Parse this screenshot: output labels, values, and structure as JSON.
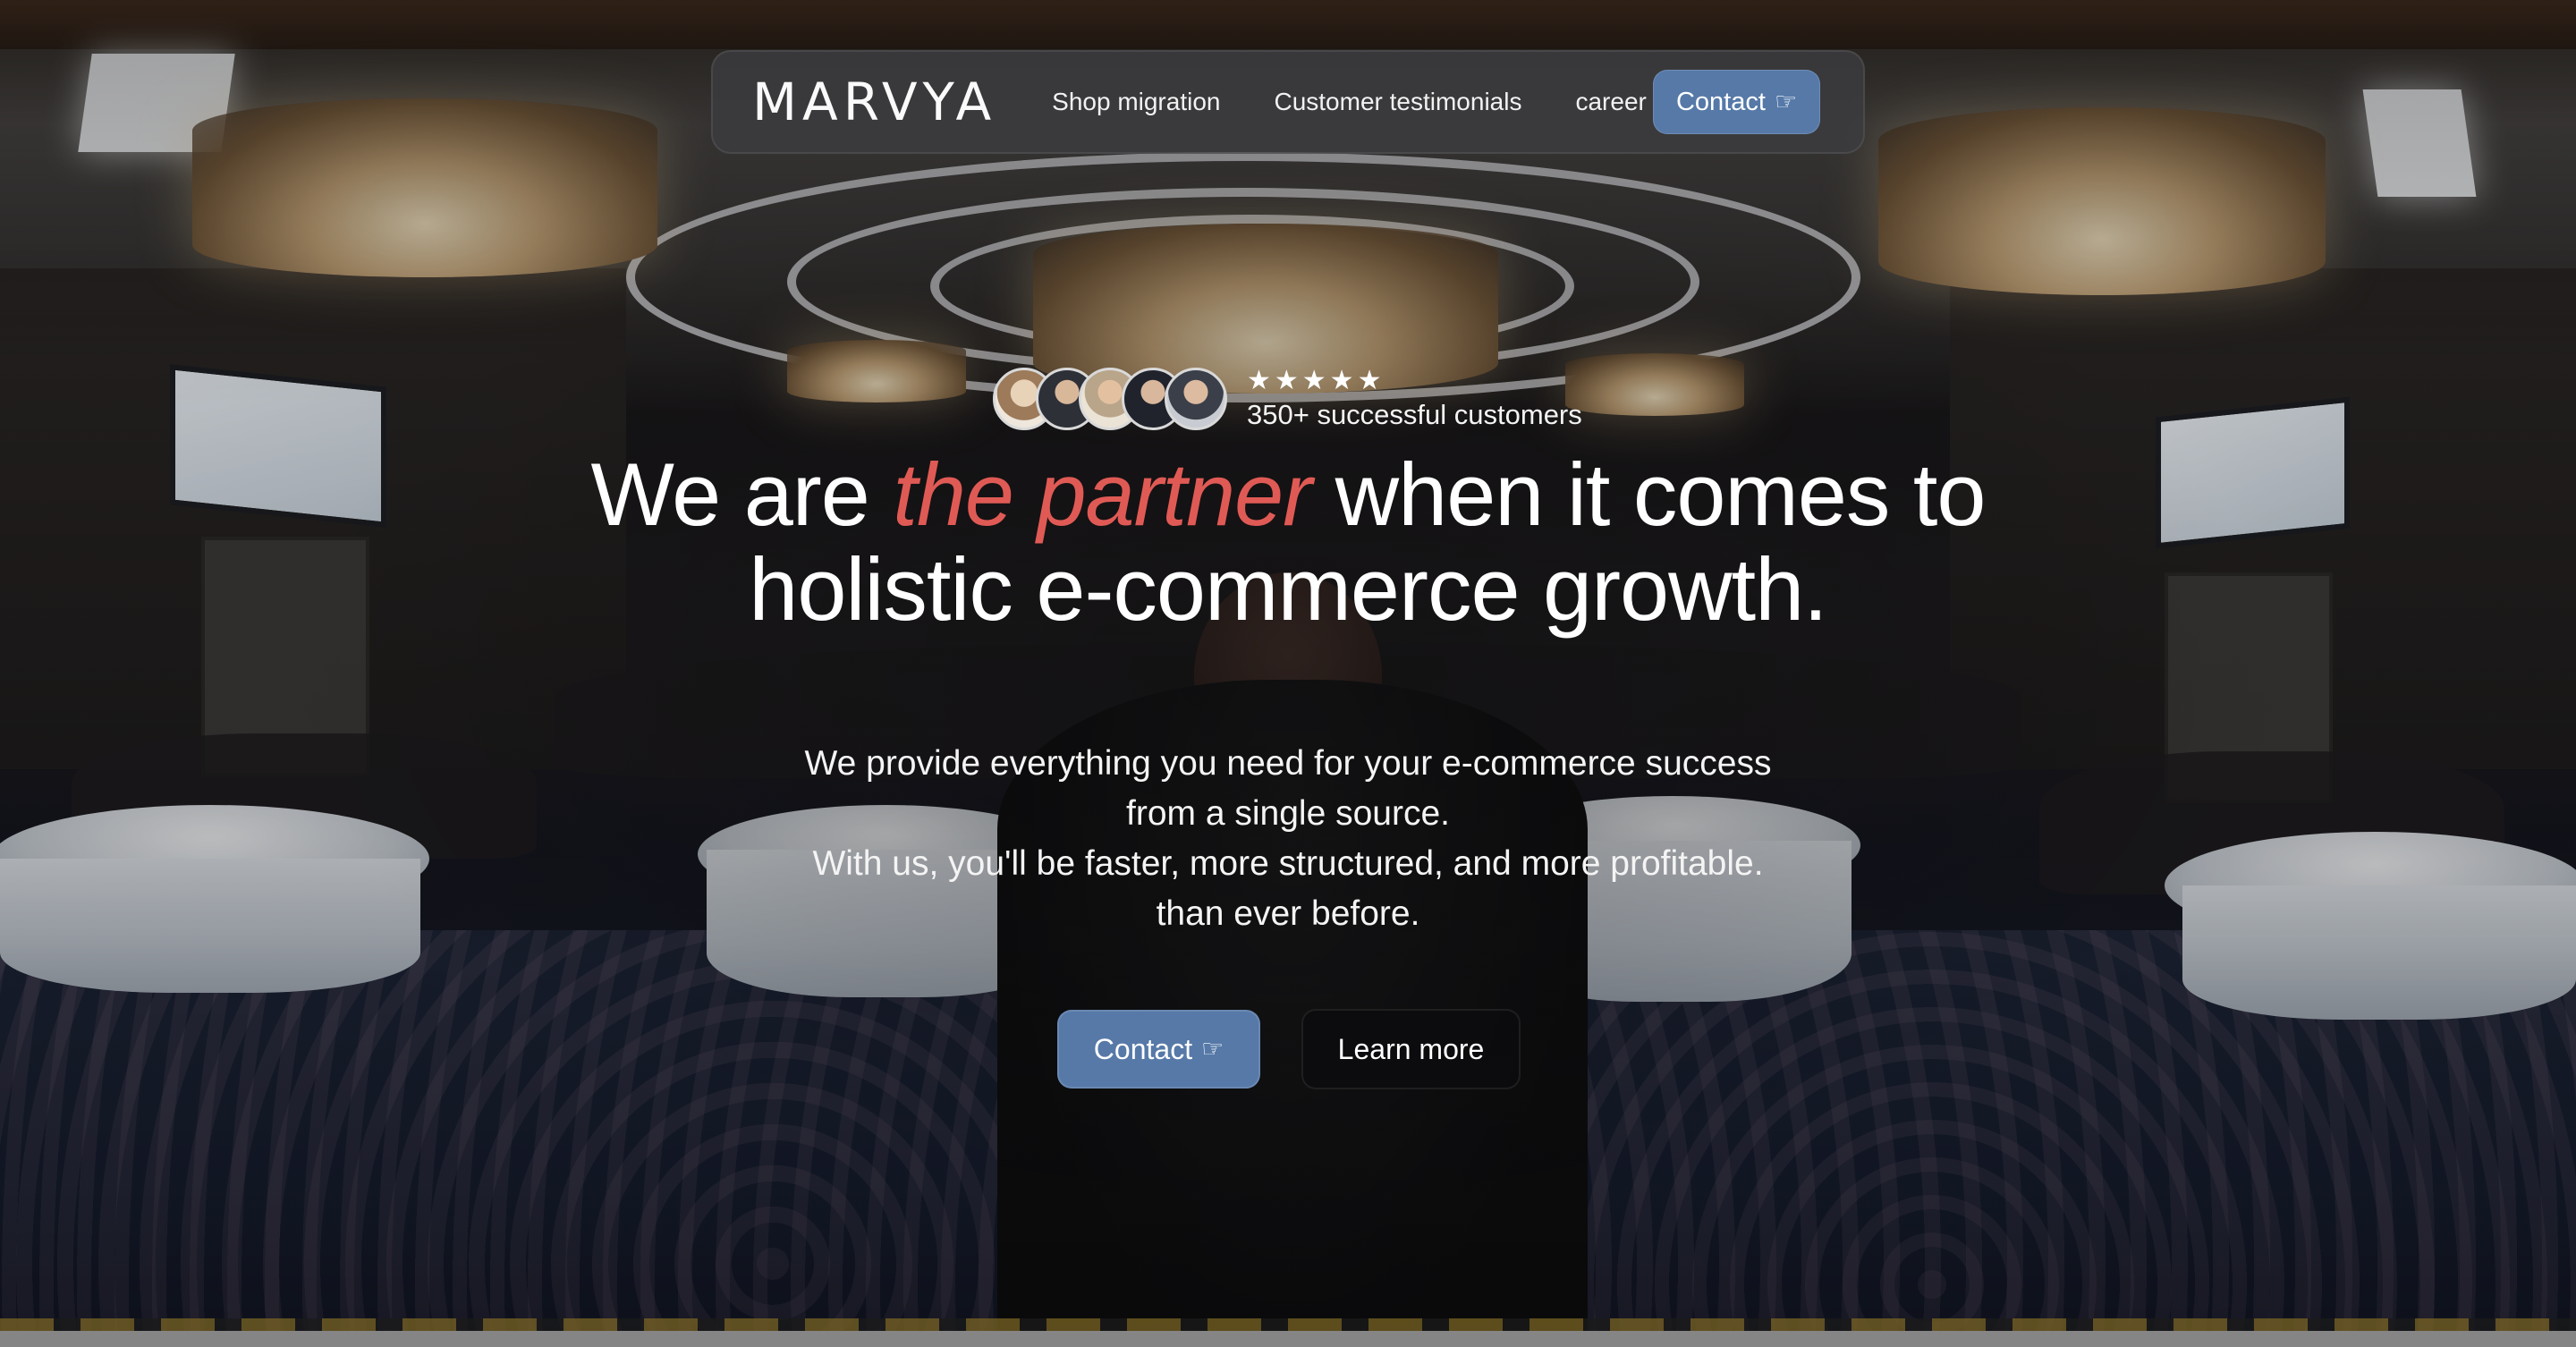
{
  "brand": {
    "logo_text": "MARVYA",
    "accent_color": "#5679a8",
    "highlight_color": "#e05a55"
  },
  "nav": {
    "links": [
      {
        "label": "Shop migration"
      },
      {
        "label": "Customer testimonials"
      },
      {
        "label": "career"
      }
    ],
    "cta_label": "Contact",
    "cta_icon": "pointing-hand-icon"
  },
  "social_proof": {
    "rating_stars": "★★★★★",
    "rating": 5,
    "label": "350+ successful customers",
    "avatar_count": 5
  },
  "hero": {
    "headline_start": "We are ",
    "headline_accent": "the partner",
    "headline_end_line1": " when it comes to",
    "headline_line2": "holistic e-commerce growth.",
    "subtext_lines": [
      "We provide everything you need for your e-commerce success",
      "from a single source.",
      "With us, you'll be faster, more structured, and more profitable.",
      "than ever before."
    ],
    "primary_button": "Contact",
    "secondary_button": "Learn more"
  }
}
